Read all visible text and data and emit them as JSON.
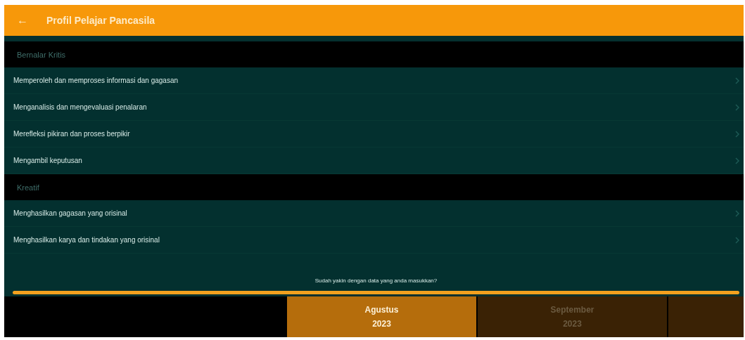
{
  "app_bar": {
    "back_icon": "←",
    "title": "Profil Pelajar Pancasila"
  },
  "sections": [
    {
      "title": "Bernalar Kritis",
      "items": [
        "Memperoleh dan memproses informasi dan gagasan",
        "Menganalisis dan mengevaluasi penalaran",
        "Merefleksi pikiran dan proses berpikir",
        "Mengambil keputusan"
      ]
    },
    {
      "title": "Kreatif",
      "items": [
        "Menghasilkan gagasan yang orisinal",
        "Menghasilkan karya dan tindakan yang orisinal"
      ]
    }
  ],
  "confirm_prompt": "Sudah yakin dengan data yang anda masukkan?",
  "progress": {
    "level": 1
  },
  "months": [
    {
      "month": "Agustus",
      "year": "2023",
      "selected": true
    },
    {
      "month": "September",
      "year": "2023",
      "selected": false
    },
    {
      "selected": false
    }
  ]
}
